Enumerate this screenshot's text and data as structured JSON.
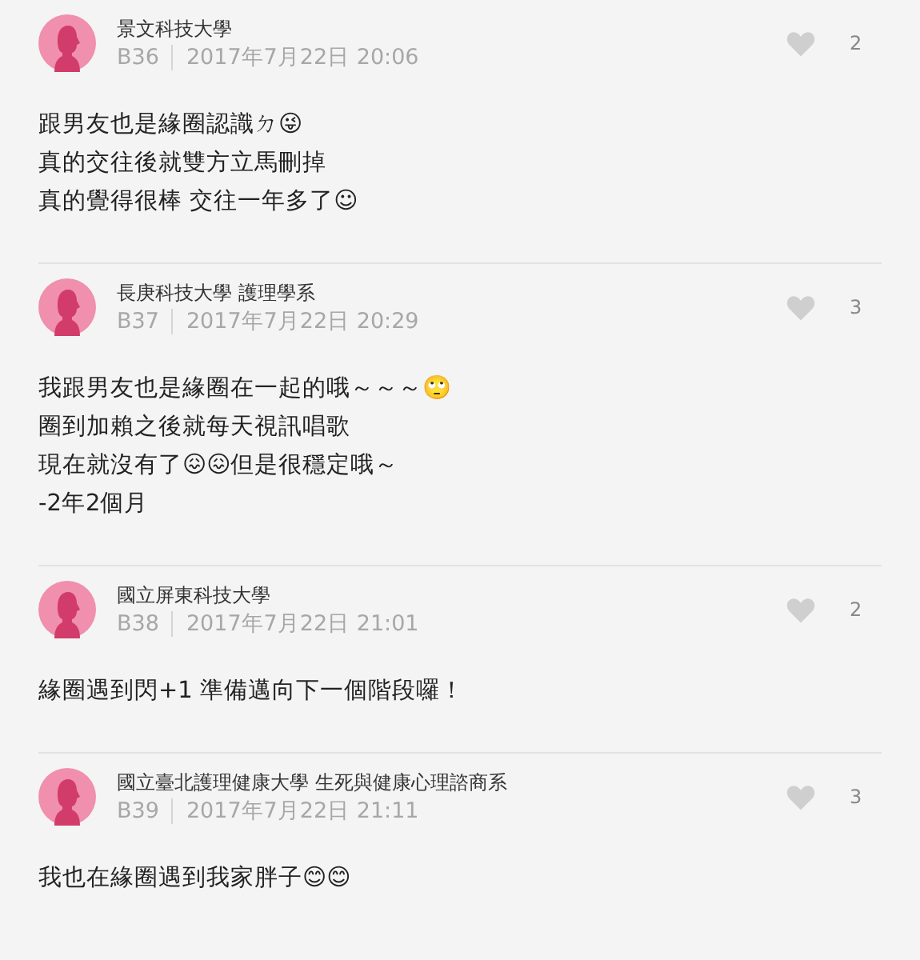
{
  "comments": [
    {
      "school": "景文科技大學",
      "floor": "B36",
      "date": "2017年7月22日 20:06",
      "likes": "2",
      "lines": [
        "跟男友也是緣圈認識ㄉ😜",
        "真的交往後就雙方立馬刪掉",
        "真的覺得很棒 交往一年多了☺"
      ]
    },
    {
      "school": "長庚科技大學 護理學系",
      "floor": "B37",
      "date": "2017年7月22日 20:29",
      "likes": "3",
      "lines": [
        "我跟男友也是緣圈在一起的哦～～～🙄",
        "圈到加賴之後就每天視訊唱歌",
        "現在就沒有了😖😖但是很穩定哦～",
        "-2年2個月"
      ]
    },
    {
      "school": "國立屏東科技大學",
      "floor": "B38",
      "date": "2017年7月22日 21:01",
      "likes": "2",
      "lines": [
        "緣圈遇到閃+1 準備邁向下一個階段囉！"
      ]
    },
    {
      "school": "國立臺北護理健康大學 生死與健康心理諮商系",
      "floor": "B39",
      "date": "2017年7月22日 21:11",
      "likes": "3",
      "lines": [
        "我也在緣圈遇到我家胖子😊😊"
      ]
    }
  ]
}
